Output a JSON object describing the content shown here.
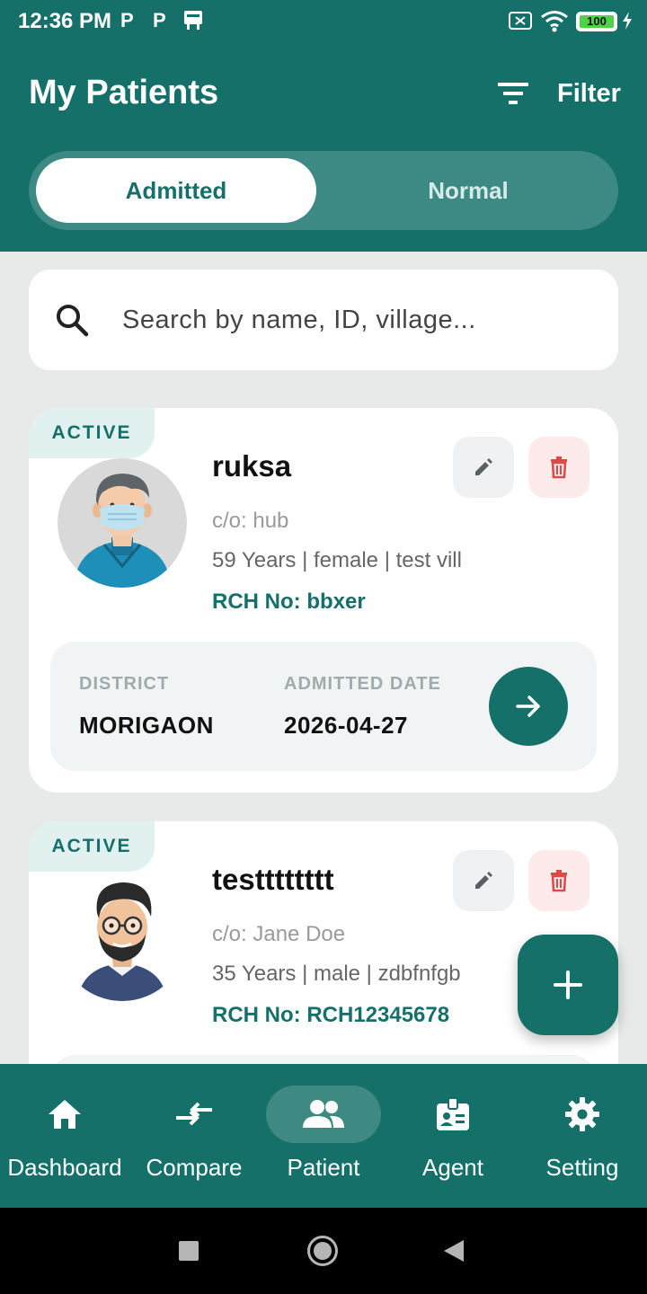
{
  "status_bar": {
    "time": "12:36 PM",
    "notif_icons": [
      "p-icon",
      "p-icon",
      "notification-icon"
    ],
    "battery": "100"
  },
  "header": {
    "title": "My Patients",
    "filter_label": "Filter"
  },
  "tabs": {
    "active": "Admitted",
    "inactive": "Normal"
  },
  "search": {
    "placeholder": "Search by name, ID, village..."
  },
  "patients": [
    {
      "status": "ACTIVE",
      "name": "ruksa",
      "co": "c/o: hub",
      "info": "59 Years | female | test vill",
      "rch": "RCH No: bbxer",
      "district_label": "DISTRICT",
      "district": "MORIGAON",
      "admitted_label": "ADMITTED DATE",
      "admitted_date": "2026-04-27"
    },
    {
      "status": "ACTIVE",
      "name": "testttttttt",
      "co": "c/o: Jane Doe",
      "info": "35 Years | male | zdbfnfgb",
      "rch": "RCH No: RCH12345678"
    }
  ],
  "bottom_nav": [
    {
      "label": "Dashboard",
      "icon": "home-icon"
    },
    {
      "label": "Compare",
      "icon": "compare-icon"
    },
    {
      "label": "Patient",
      "icon": "people-icon",
      "selected": true
    },
    {
      "label": "Agent",
      "icon": "badge-icon"
    },
    {
      "label": "Setting",
      "icon": "gear-icon"
    }
  ],
  "colors": {
    "primary": "#15706a",
    "delete": "#e04848",
    "background": "#e8eaea"
  }
}
